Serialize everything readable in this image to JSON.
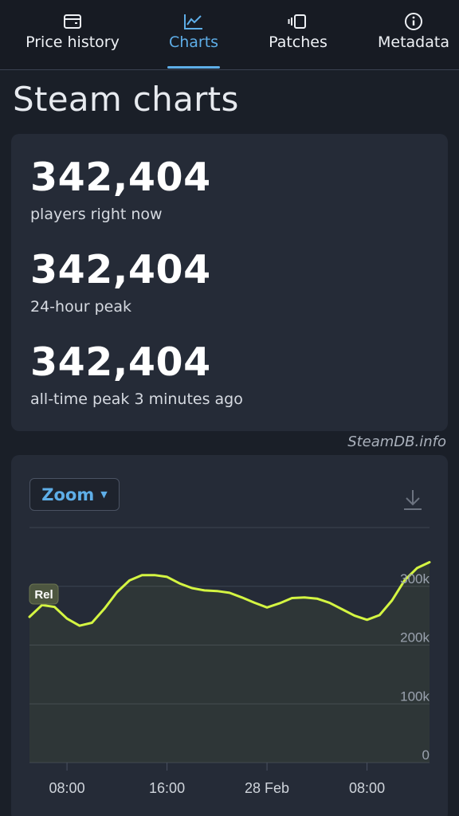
{
  "tabs": [
    {
      "label": "Price history",
      "icon": "wallet-icon"
    },
    {
      "label": "Charts",
      "icon": "line-chart-icon",
      "active": true
    },
    {
      "label": "Patches",
      "icon": "patches-icon"
    },
    {
      "label": "Metadata",
      "icon": "info-icon"
    }
  ],
  "page_title": "Steam charts",
  "stats": [
    {
      "value": "342,404",
      "label": "players right now"
    },
    {
      "value": "342,404",
      "label": "24-hour peak"
    },
    {
      "value": "342,404",
      "label": "all-time peak 3 minutes ago"
    }
  ],
  "credit": "SteamDB.info",
  "chart_controls": {
    "zoom_label": "Zoom"
  },
  "colors": {
    "accent": "#5eaee8",
    "line": "#d4f542",
    "background": "#1a1f28",
    "card": "#252b37"
  },
  "chart_data": {
    "type": "line",
    "x_ticks": [
      "08:00",
      "16:00",
      "28 Feb",
      "08:00"
    ],
    "y_ticks": [
      "0",
      "100k",
      "200k",
      "300k"
    ],
    "ylim": [
      0,
      400000
    ],
    "grid": true,
    "annotation": "Rel",
    "x_hours": [
      0,
      1,
      2,
      3,
      4,
      5,
      6,
      7,
      8,
      9,
      10,
      11,
      12,
      13,
      14,
      15,
      16,
      17,
      18,
      19,
      20,
      21,
      22,
      23,
      24,
      25,
      26,
      27,
      28,
      29,
      30,
      31,
      32
    ],
    "values": [
      248000,
      268000,
      265000,
      245000,
      233000,
      238000,
      262000,
      290000,
      310000,
      319000,
      319000,
      316000,
      305000,
      297000,
      293000,
      292000,
      289000,
      281000,
      272000,
      264000,
      271000,
      280000,
      281000,
      279000,
      272000,
      261000,
      250000,
      243000,
      251000,
      276000,
      310000,
      331000,
      341000
    ],
    "x_tick_hours": [
      3,
      11,
      19,
      27
    ]
  }
}
